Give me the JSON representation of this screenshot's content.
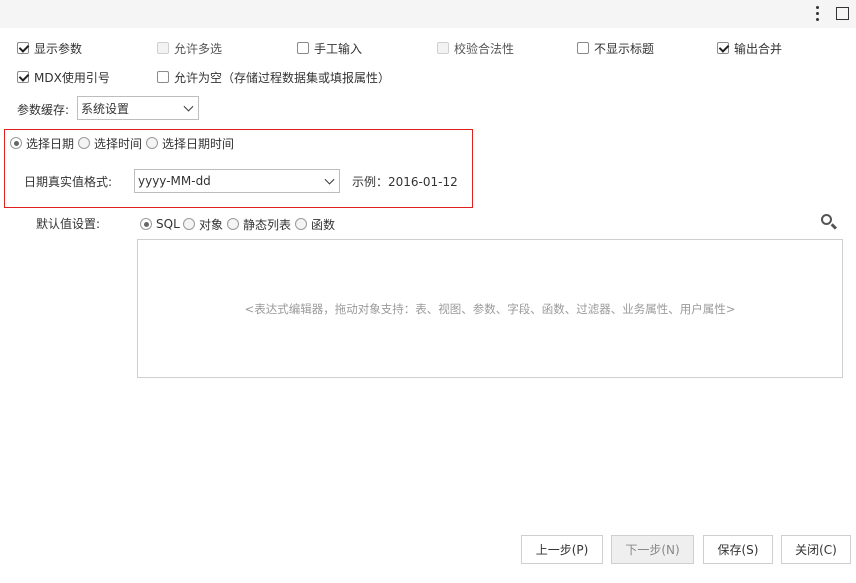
{
  "toolbar": {
    "more_icon": "more-vertical-icon",
    "maximize_icon": "maximize-icon"
  },
  "options_row1": [
    {
      "label": "显示参数",
      "checked": true,
      "disabled": false
    },
    {
      "label": "允许多选",
      "checked": false,
      "disabled": true
    },
    {
      "label": "手工输入",
      "checked": false,
      "disabled": false
    },
    {
      "label": "校验合法性",
      "checked": false,
      "disabled": true
    },
    {
      "label": "不显示标题",
      "checked": false,
      "disabled": false
    },
    {
      "label": "输出合并",
      "checked": true,
      "disabled": false
    }
  ],
  "options_row2": [
    {
      "label": "MDX使用引号",
      "checked": true,
      "disabled": false
    },
    {
      "label": "允许为空（存储过程数据集或填报属性）",
      "checked": false,
      "disabled": false
    }
  ],
  "cache": {
    "label": "参数缓存:",
    "value": "系统设置"
  },
  "date_type": {
    "options": [
      "选择日期",
      "选择时间",
      "选择日期时间"
    ],
    "selected": "选择日期"
  },
  "date_format": {
    "label": "日期真实值格式:",
    "value": "yyyy-MM-dd",
    "example": "示例：2016-01-12"
  },
  "default_value": {
    "label": "默认值设置:",
    "options": [
      "SQL",
      "对象",
      "静态列表",
      "函数"
    ],
    "selected": "SQL",
    "search_icon": "search-icon",
    "editor_placeholder": "<表达式编辑器，拖动对象支持：表、视图、参数、字段、函数、过滤器、业务属性、用户属性>"
  },
  "buttons": {
    "prev": "上一步(P)",
    "next": "下一步(N)",
    "save": "保存(S)",
    "close": "关闭(C)"
  }
}
